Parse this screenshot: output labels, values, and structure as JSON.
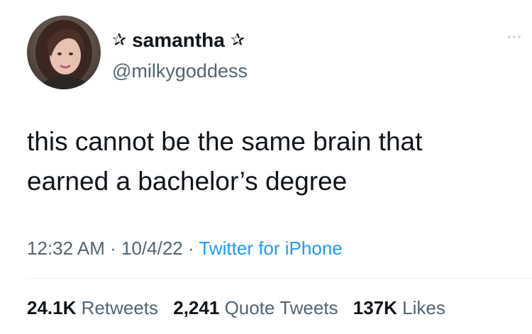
{
  "user": {
    "display_name": "samantha",
    "handle": "@milkygoddess",
    "name_decoration": "✰",
    "avatar": "profile-photo"
  },
  "tweet": {
    "text_lines": [
      "this cannot be the same brain that",
      "earned a bachelor’s degree"
    ],
    "time": "12:32 AM",
    "separator": "·",
    "date": "10/4/22",
    "source": "Twitter for iPhone"
  },
  "stats": {
    "retweets_count": "24.1K",
    "retweets_label": "Retweets",
    "quotes_count": "2,241",
    "quotes_label": "Quote Tweets",
    "likes_count": "137K",
    "likes_label": "Likes"
  },
  "icons": {
    "more": "more-dots-icon",
    "star": "star-outline-icon"
  },
  "colors": {
    "text_primary": "#0f1419",
    "text_secondary": "#536471",
    "link_blue": "#1d9bf0",
    "divider": "#eff3f4"
  }
}
